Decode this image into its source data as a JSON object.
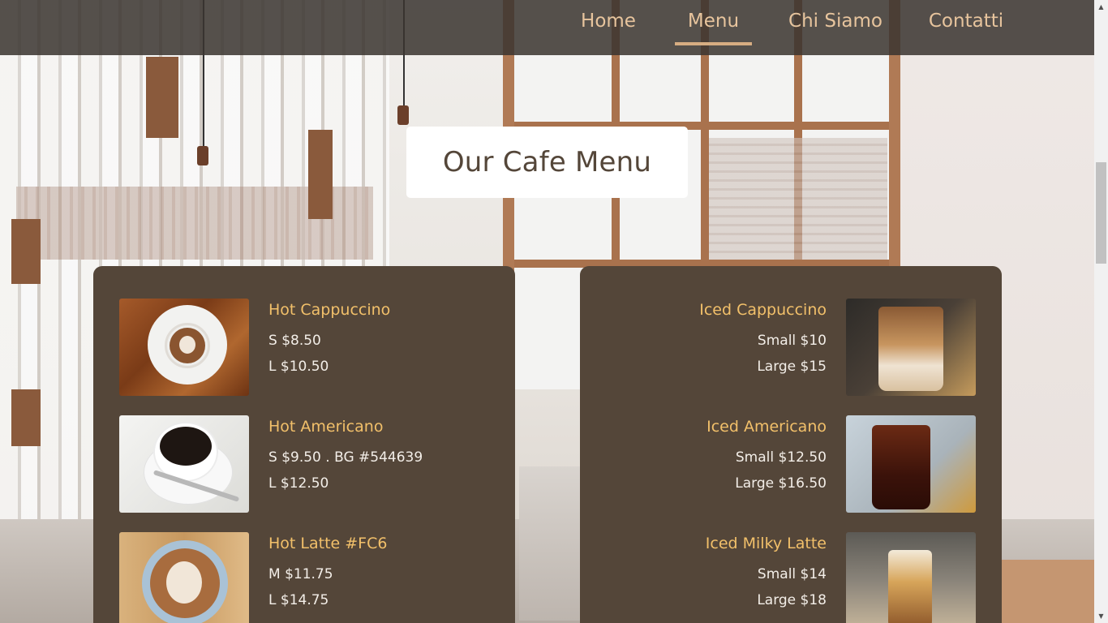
{
  "nav": {
    "items": [
      {
        "label": "Home",
        "active": false
      },
      {
        "label": "Menu",
        "active": true
      },
      {
        "label": "Chi Siamo",
        "active": false
      },
      {
        "label": "Contatti",
        "active": false
      }
    ],
    "active_underline_color": "#d7ad82",
    "text_color": "#e7c49d"
  },
  "page": {
    "title": "Our Cafe Menu"
  },
  "colors": {
    "card_background": "#544639",
    "item_name": "#f2c06a",
    "item_price": "#f3eee8"
  },
  "menu": {
    "hot": [
      {
        "name": "Hot Cappuccino",
        "prices": [
          "S $8.50",
          "L $10.50"
        ],
        "image": "cappuccino-top-view-photo"
      },
      {
        "name": "Hot Americano",
        "prices": [
          "S $9.50 . BG #544639",
          "L $12.50"
        ],
        "image": "americano-cup-photo"
      },
      {
        "name": "Hot Latte #FC6",
        "prices": [
          "M $11.75",
          "L $14.75"
        ],
        "image": "latte-art-photo"
      }
    ],
    "iced": [
      {
        "name": "Iced Cappuccino",
        "prices": [
          "Small $10",
          "Large $15"
        ],
        "image": "iced-cappuccino-photo"
      },
      {
        "name": "Iced Americano",
        "prices": [
          "Small $12.50",
          "Large $16.50"
        ],
        "image": "iced-americano-photo"
      },
      {
        "name": "Iced Milky Latte",
        "prices": [
          "Small $14",
          "Large $18"
        ],
        "image": "iced-milky-latte-photo"
      }
    ]
  }
}
